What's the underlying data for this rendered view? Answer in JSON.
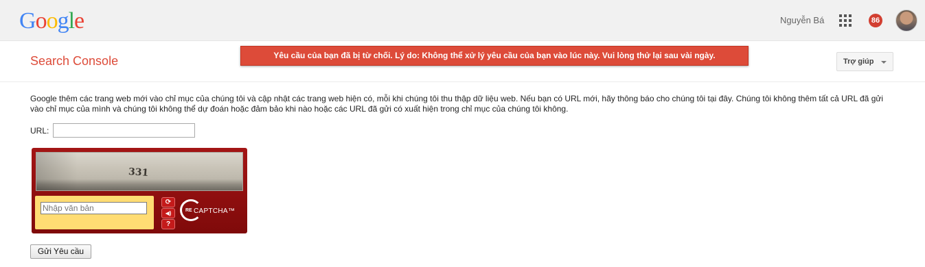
{
  "topbar": {
    "logo_letters": [
      {
        "ch": "G",
        "color": "#4285f4"
      },
      {
        "ch": "o",
        "color": "#ea4335"
      },
      {
        "ch": "o",
        "color": "#fbbc05"
      },
      {
        "ch": "g",
        "color": "#4285f4"
      },
      {
        "ch": "l",
        "color": "#34a853"
      },
      {
        "ch": "e",
        "color": "#ea4335"
      }
    ],
    "user_name": "Nguyễn Bá",
    "apps_icon": "apps-grid-icon",
    "notification_count": "86",
    "avatar": "user-avatar"
  },
  "header": {
    "product_title": "Search Console",
    "error_message": "Yêu cầu của bạn đã bị từ chối. Lý do: Không thể xử lý yêu cầu của bạn vào lúc này. Vui lòng thử lại sau vài ngày.",
    "help_label": "Trợ giúp"
  },
  "form": {
    "description": "Google thêm các trang web mới vào chỉ mục của chúng tôi và cập nhật các trang web hiện có, mỗi khi chúng tôi thu thập dữ liệu web. Nếu bạn có URL mới, hãy thông báo cho chúng tôi tại đây. Chúng tôi không thêm tất cả URL đã gửi vào chỉ mục của mình và chúng tôi không thể dự đoán hoặc đảm bảo khi nào hoặc các URL đã gửi có xuất hiện trong chỉ mục của chúng tôi không.",
    "url_label": "URL:",
    "url_value": "",
    "submit_label": "Gửi Yêu cầu"
  },
  "captcha": {
    "challenge_text": "331",
    "input_placeholder": "Nhập văn bản",
    "buttons": [
      {
        "name": "refresh-icon",
        "glyph": "⟳"
      },
      {
        "name": "audio-icon",
        "glyph": "◀)"
      },
      {
        "name": "help-icon",
        "glyph": "?"
      }
    ],
    "brand_re": "RE",
    "brand_word": "CAPTCHA™"
  }
}
